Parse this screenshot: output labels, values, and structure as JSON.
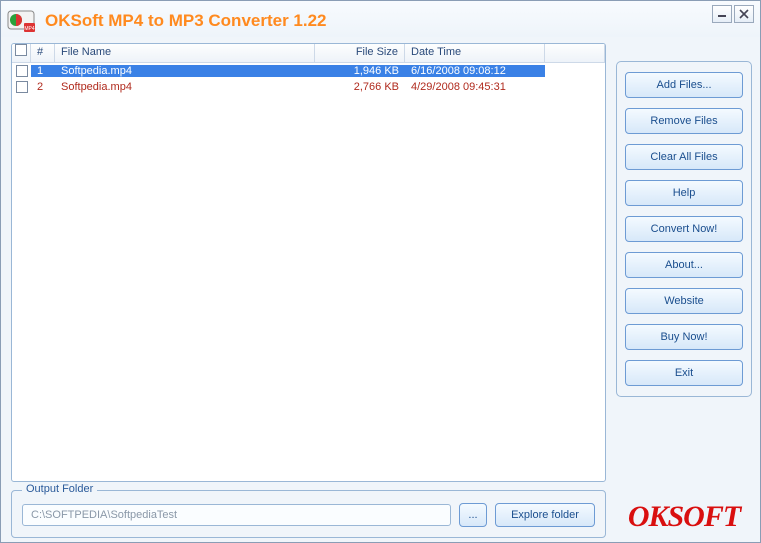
{
  "app": {
    "title": "OKSoft MP4 to MP3 Converter 1.22",
    "brand": "OKSOFT"
  },
  "columns": {
    "num": "#",
    "name": "File Name",
    "size": "File Size",
    "date": "Date Time"
  },
  "files": [
    {
      "num": "1",
      "name": "Softpedia.mp4",
      "size": "1,946 KB",
      "date": "6/16/2008 09:08:12",
      "selected": true
    },
    {
      "num": "2",
      "name": "Softpedia.mp4",
      "size": "2,766 KB",
      "date": "4/29/2008 09:45:31",
      "selected": false
    }
  ],
  "sidebar": {
    "add": "Add Files...",
    "remove": "Remove Files",
    "clear": "Clear All Files",
    "help": "Help",
    "convert": "Convert Now!",
    "about": "About...",
    "website": "Website",
    "buy": "Buy Now!",
    "exit": "Exit"
  },
  "output": {
    "legend": "Output Folder",
    "path": "C:\\SOFTPEDIA\\SoftpediaTest",
    "browse": "...",
    "explore": "Explore folder"
  }
}
